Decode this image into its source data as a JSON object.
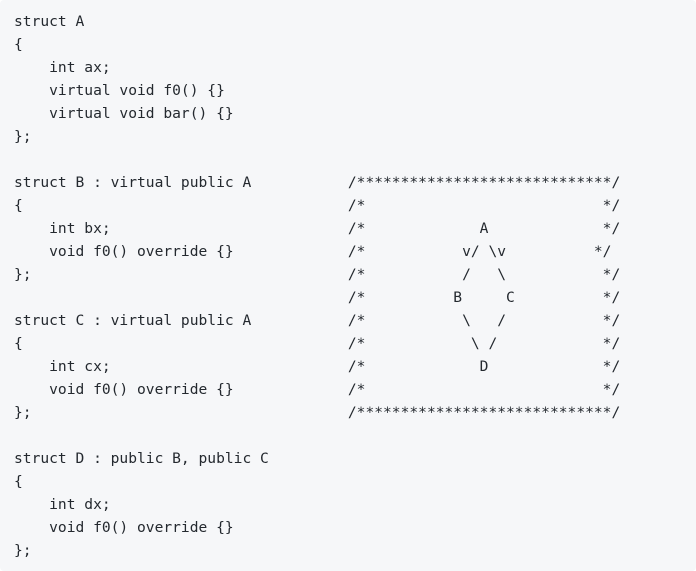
{
  "code": {
    "lines": [
      "struct A",
      "{",
      "    int ax;",
      "    virtual void f0() {}",
      "    virtual void bar() {}",
      "};",
      "",
      "struct B : virtual public A           /*****************************/",
      "{                                     /*                           */",
      "    int bx;                           /*             A             */",
      "    void f0() override {}             /*           v/ \\v          */",
      "};                                    /*           /   \\           */",
      "                                      /*          B     C          */",
      "struct C : virtual public A           /*           \\   /           */",
      "{                                     /*            \\ /            */",
      "    int cx;                           /*             D             */",
      "    void f0() override {}             /*                           */",
      "};                                    /*****************************/",
      "",
      "struct D : public B, public C",
      "{",
      "    int dx;",
      "    void f0() override {}",
      "};"
    ]
  }
}
